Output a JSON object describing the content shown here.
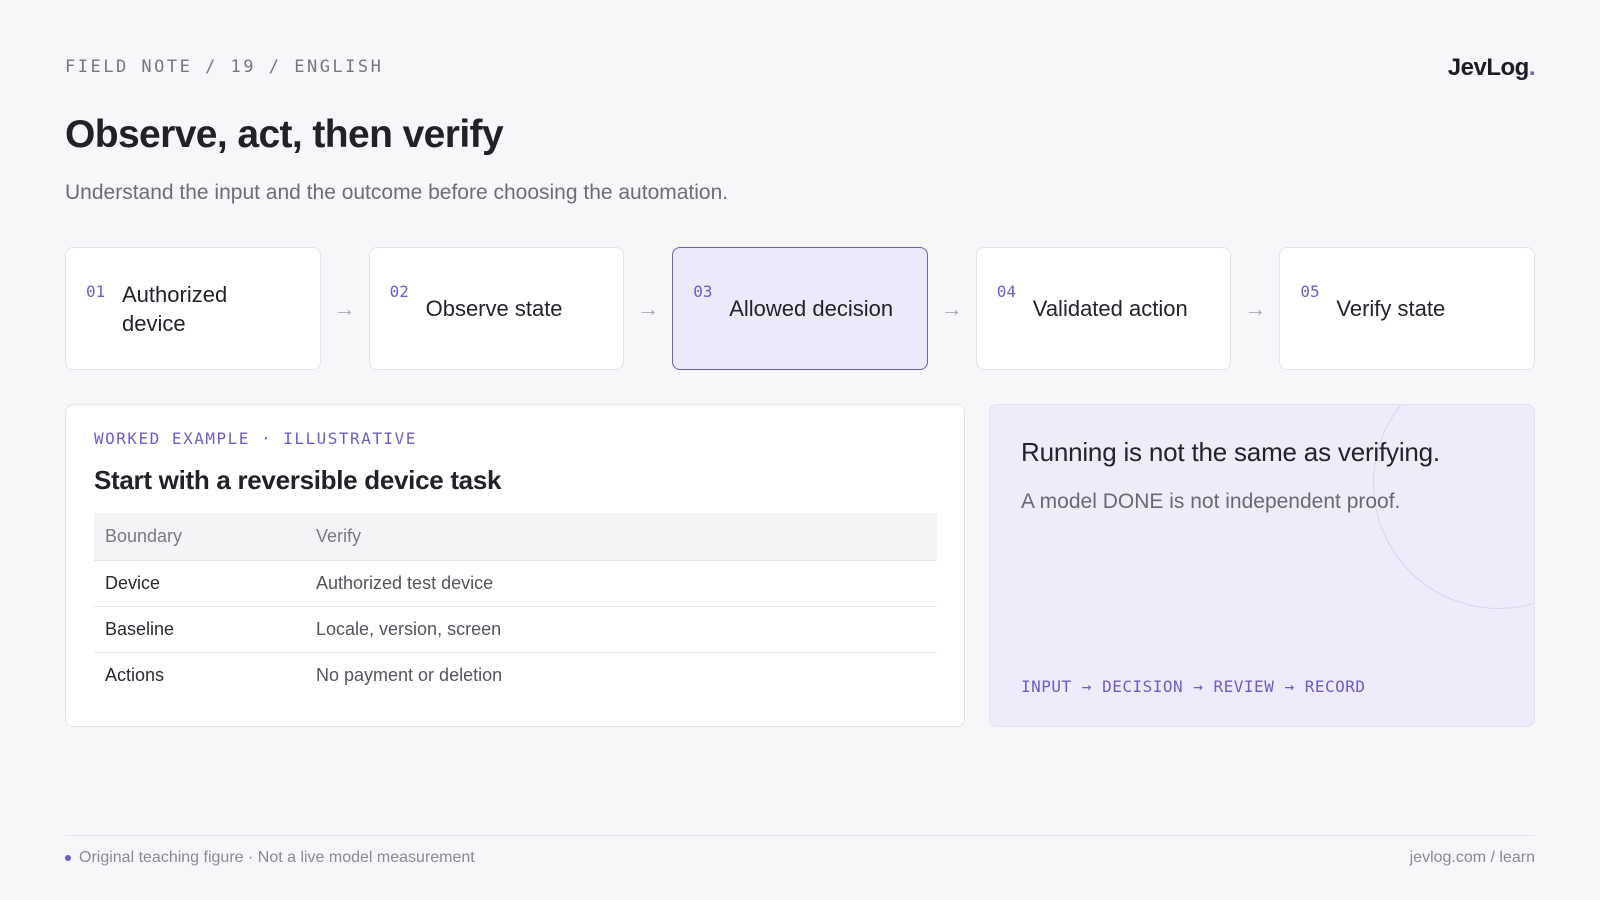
{
  "header": {
    "eyebrow": "FIELD NOTE / 19 / ENGLISH",
    "brand_name": "JevLog",
    "brand_dot": ".",
    "title": "Observe, act, then verify",
    "subtitle": "Understand the input and the outcome before choosing the automation."
  },
  "steps": [
    {
      "num": "01",
      "label": "Authorized device",
      "active": false
    },
    {
      "num": "02",
      "label": "Observe state",
      "active": false
    },
    {
      "num": "03",
      "label": "Allowed decision",
      "active": true
    },
    {
      "num": "04",
      "label": "Validated action",
      "active": false
    },
    {
      "num": "05",
      "label": "Verify state",
      "active": false
    }
  ],
  "arrow_glyph": "→",
  "example": {
    "kicker": "WORKED EXAMPLE · ILLUSTRATIVE",
    "title": "Start with a reversible device task",
    "columns": [
      "Boundary",
      "Verify"
    ],
    "rows": [
      [
        "Device",
        "Authorized test device"
      ],
      [
        "Baseline",
        "Locale, version, screen"
      ],
      [
        "Actions",
        "No payment or deletion"
      ]
    ]
  },
  "callout": {
    "title": "Running is not the same as verifying.",
    "body": "A model DONE is not independent proof.",
    "flow": "INPUT → DECISION → REVIEW → RECORD"
  },
  "footer": {
    "note": "Original teaching figure · Not a live model measurement",
    "link": "jevlog.com / learn"
  },
  "colors": {
    "accent": "#6b5fc7",
    "active_step_bg": "#ece9fa",
    "callout_bg": "#eeebfa"
  }
}
